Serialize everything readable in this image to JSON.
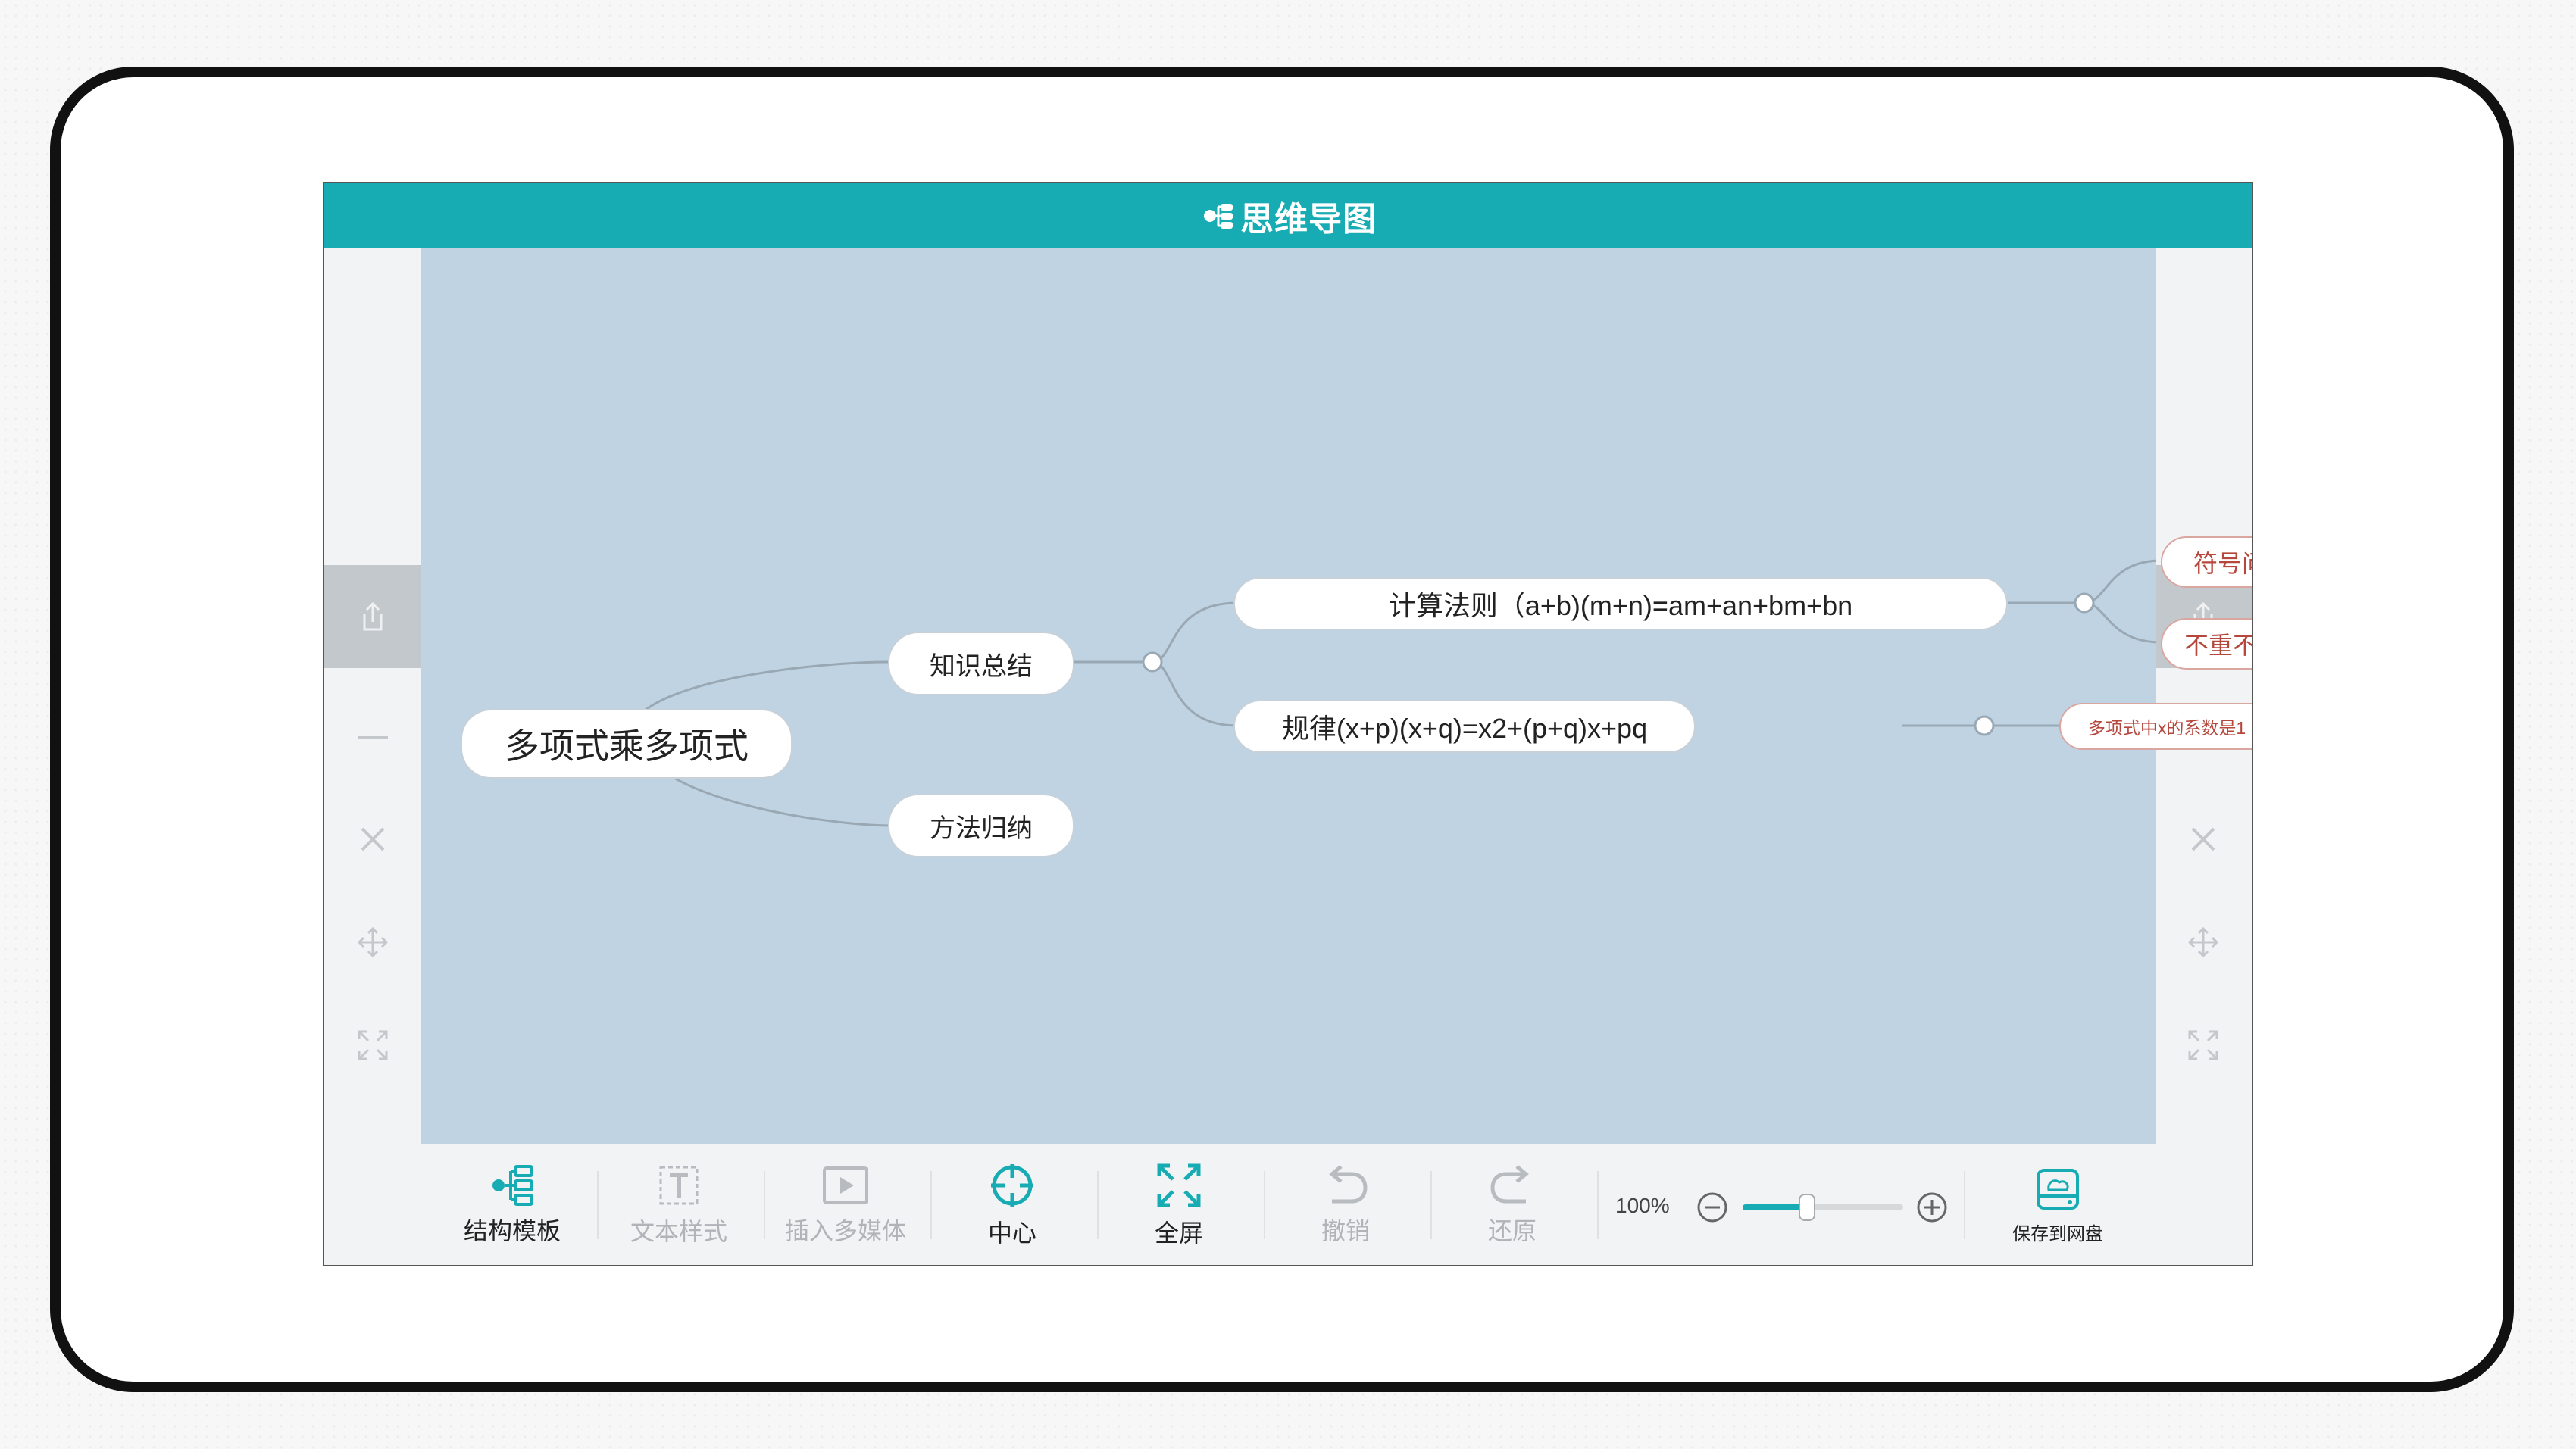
{
  "app": {
    "title": "思维导图"
  },
  "mindmap": {
    "root": "多项式乘多项式",
    "branches": [
      {
        "label": "知识总结",
        "children": [
          {
            "label": "计算法则（a+b)(m+n)=am+an+bm+bn",
            "children": [
              "符号问题",
              "不重不漏"
            ]
          },
          {
            "label": "规律(x+p)(x+q)=x2+(p+q)x+pq",
            "children": [
              "多项式中x的系数是1"
            ]
          }
        ]
      },
      {
        "label": "方法归纳"
      }
    ]
  },
  "toolbar": {
    "structure_template": "结构模板",
    "text_style": "文本样式",
    "insert_media": "插入多媒体",
    "center": "中心",
    "fullscreen": "全屏",
    "undo": "撤销",
    "redo": "还原",
    "zoom_level": "100%",
    "zoom_fraction": 0.4,
    "save_to_cloud": "保存到网盘"
  },
  "colors": {
    "accent": "#17acb3",
    "canvas": "#bfd3e2",
    "leaf_text": "#b5473c"
  },
  "icons": {
    "title": "mindmap-logo-icon",
    "sidebar": [
      "share-icon",
      "minus-icon",
      "close-icon",
      "move-icon",
      "fit-screen-icon"
    ]
  }
}
